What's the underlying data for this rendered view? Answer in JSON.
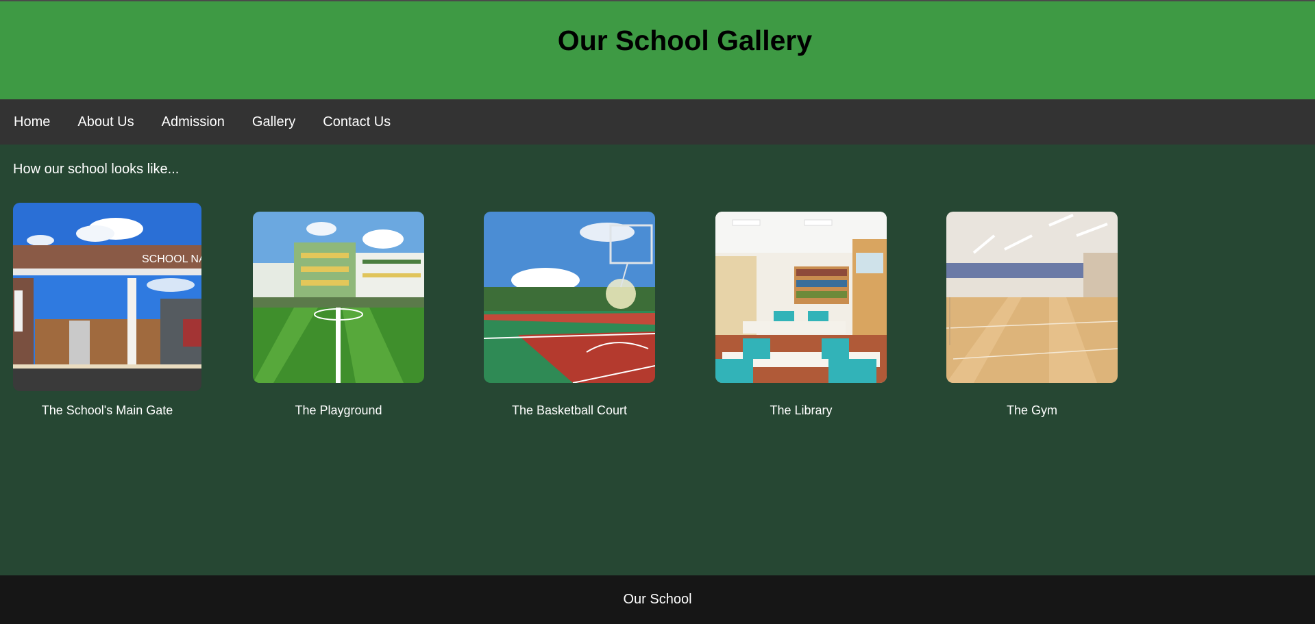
{
  "header": {
    "title": "Our School Gallery"
  },
  "nav": {
    "items": [
      {
        "label": "Home"
      },
      {
        "label": "About Us"
      },
      {
        "label": "Admission"
      },
      {
        "label": "Gallery"
      },
      {
        "label": "Contact Us"
      }
    ]
  },
  "intro": {
    "text": "How our school looks like..."
  },
  "gallery": [
    {
      "caption": "The School's Main Gate",
      "sign": "SCHOOL NA"
    },
    {
      "caption": "The Playground"
    },
    {
      "caption": "The Basketball Court"
    },
    {
      "caption": "The Library"
    },
    {
      "caption": "The Gym"
    }
  ],
  "footer": {
    "text": "Our School"
  },
  "colors": {
    "header_bg": "#3e9a44",
    "nav_bg": "#333333",
    "page_bg": "#264733",
    "footer_bg": "#161616"
  }
}
